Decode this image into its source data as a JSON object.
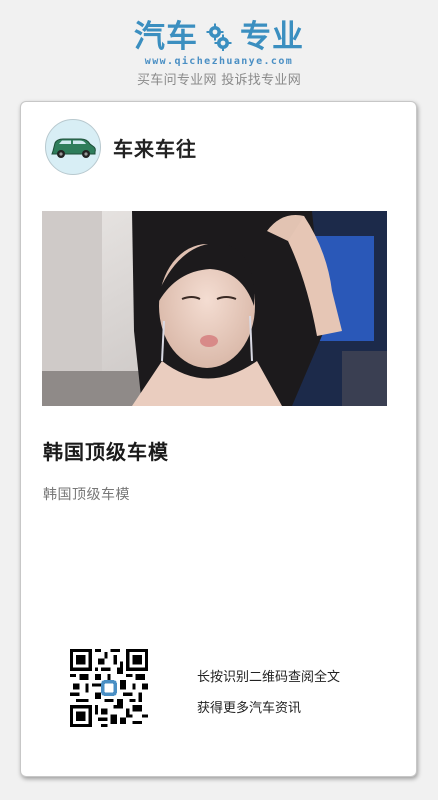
{
  "brand": {
    "name_part1": "汽车",
    "name_part2": "专业",
    "gear_icon": "gear-icon",
    "domain": "www.qichezhuanye.com",
    "slogan": "买车问专业网 投诉找专业网",
    "color": "#3b8fc0"
  },
  "author": {
    "name": "车来车往",
    "avatar_icon": "car-icon"
  },
  "article": {
    "title": "韩国顶级车模",
    "summary": "韩国顶级车模"
  },
  "footer": {
    "qr_icon": "qr-code-icon",
    "line1": "长按识别二维码查阅全文",
    "line2": "获得更多汽车资讯"
  }
}
